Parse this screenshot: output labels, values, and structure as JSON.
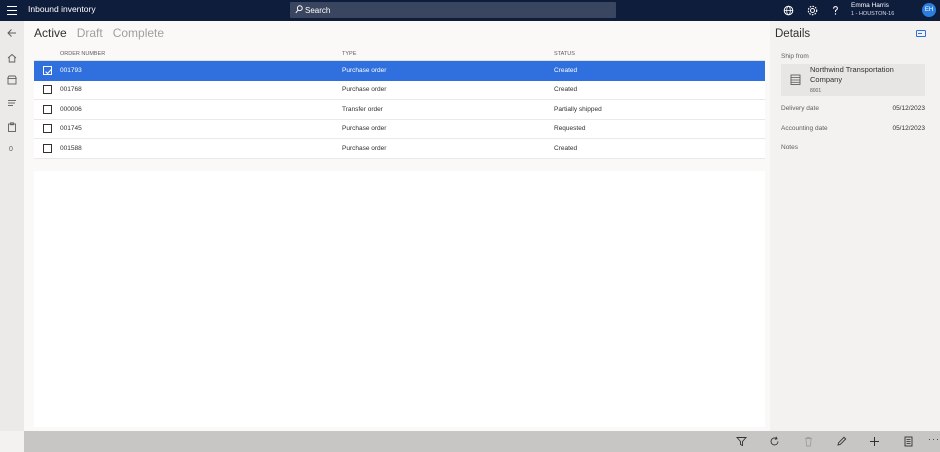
{
  "app": {
    "title": "Inbound inventory"
  },
  "search": {
    "placeholder": "Search"
  },
  "user": {
    "name": "Emma Harris",
    "location": "1 - HOUSTON-16",
    "initials": "EH"
  },
  "rail": {
    "count": "0"
  },
  "tabs": [
    {
      "label": "Active",
      "active": true
    },
    {
      "label": "Draft",
      "active": false
    },
    {
      "label": "Complete",
      "active": false
    }
  ],
  "table": {
    "columns": [
      "ORDER NUMBER",
      "TYPE",
      "STATUS"
    ],
    "rows": [
      {
        "order": "001793",
        "type": "Purchase order",
        "status": "Created",
        "selected": true
      },
      {
        "order": "001768",
        "type": "Purchase order",
        "status": "Created",
        "selected": false
      },
      {
        "order": "000006",
        "type": "Transfer order",
        "status": "Partially shipped",
        "selected": false
      },
      {
        "order": "001745",
        "type": "Purchase order",
        "status": "Requested",
        "selected": false
      },
      {
        "order": "001588",
        "type": "Purchase order",
        "status": "Created",
        "selected": false
      }
    ]
  },
  "details": {
    "title": "Details",
    "ship_from_label": "Ship from",
    "ship_from_name": "Northwind Transportation Company",
    "ship_from_code": "8001",
    "delivery_date_label": "Delivery date",
    "delivery_date": "05/12/2023",
    "accounting_date_label": "Accounting date",
    "accounting_date": "05/12/2023",
    "notes_label": "Notes"
  },
  "bottombar": {
    "more": "···"
  },
  "colors": {
    "topbar": "#0f1d3c",
    "selection": "#2f6fde",
    "avatar": "#2b7de0",
    "bottombar": "#c8c6c4"
  }
}
